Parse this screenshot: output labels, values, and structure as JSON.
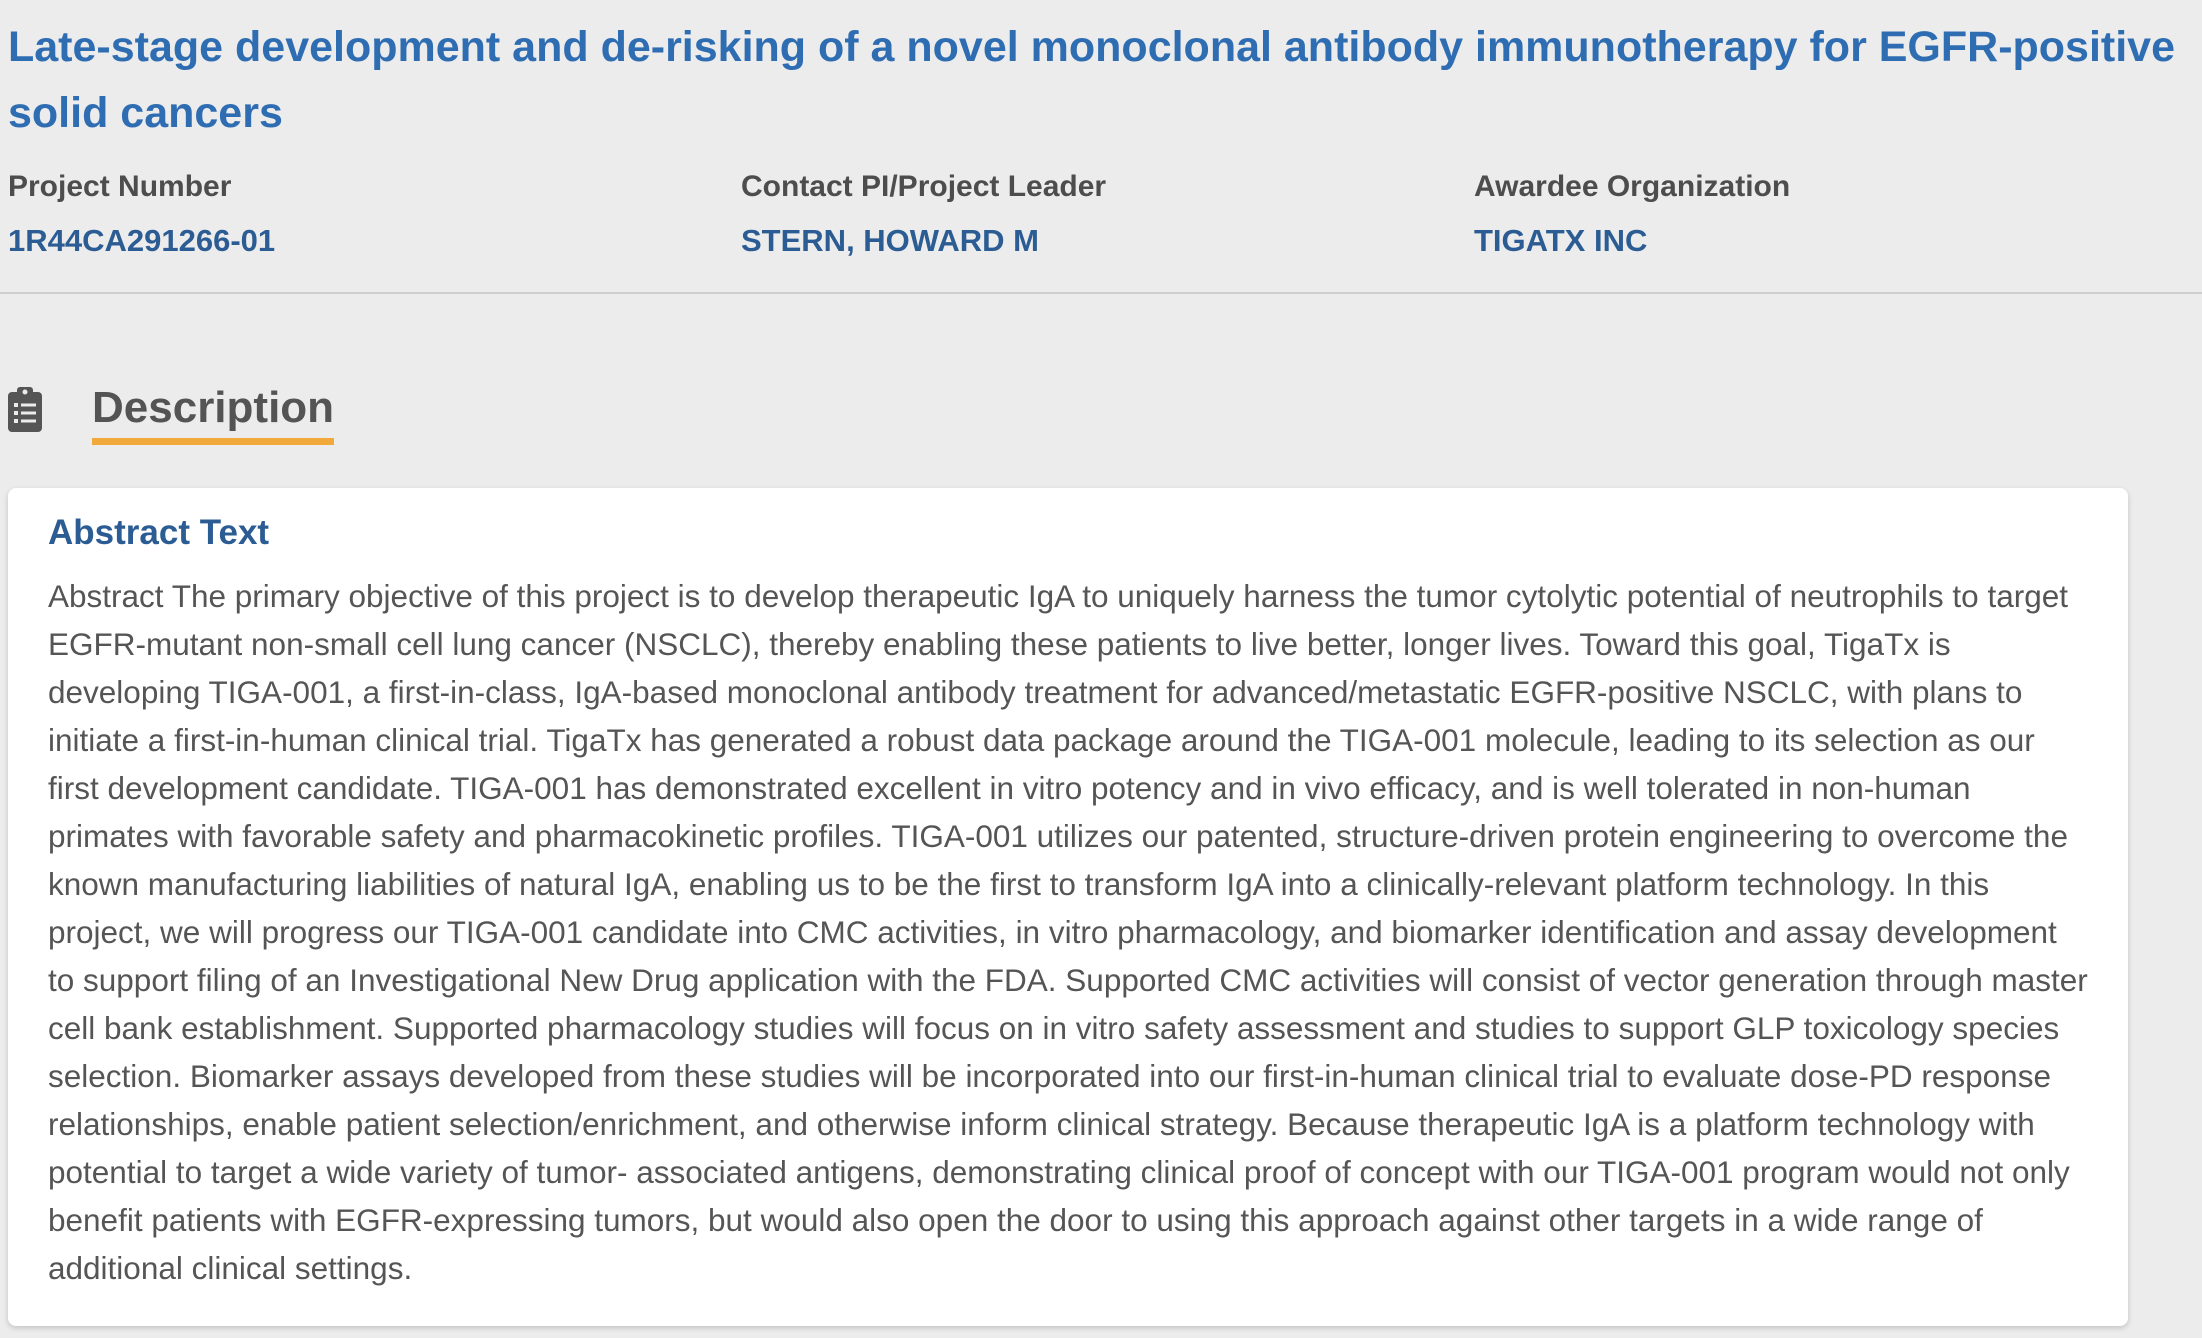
{
  "project": {
    "title": "Late-stage development and de-risking of a novel monoclonal antibody immunotherapy for EGFR-positive solid cancers"
  },
  "meta": {
    "project_number_label": "Project Number",
    "project_number_value": "1R44CA291266-01",
    "contact_pi_label": "Contact PI/Project Leader",
    "contact_pi_value": "STERN, HOWARD M",
    "awardee_label": "Awardee Organization",
    "awardee_value": "TIGATX INC"
  },
  "section": {
    "icon": "clipboard-list-icon",
    "title": "Description"
  },
  "abstract": {
    "heading": "Abstract Text",
    "body": "Abstract The primary objective of this project is to develop therapeutic IgA to uniquely harness the tumor cytolytic potential of neutrophils to target EGFR-mutant non-small cell lung cancer (NSCLC), thereby enabling these patients to live better, longer lives. Toward this goal, TigaTx is developing TIGA-001, a first-in-class, IgA-based monoclonal antibody treatment for advanced/metastatic EGFR-positive NSCLC, with plans to initiate a first-in-human clinical trial. TigaTx has generated a robust data package around the TIGA-001 molecule, leading to its selection as our first development candidate. TIGA-001 has demonstrated excellent in vitro potency and in vivo efficacy, and is well tolerated in non-human primates with favorable safety and pharmacokinetic profiles. TIGA-001 utilizes our patented, structure-driven protein engineering to overcome the known manufacturing liabilities of natural IgA, enabling us to be the first to transform IgA into a clinically-relevant platform technology. In this project, we will progress our TIGA-001 candidate into CMC activities, in vitro pharmacology, and biomarker identification and assay development to support filing of an Investigational New Drug application with the FDA. Supported CMC activities will consist of vector generation through master cell bank establishment. Supported pharmacology studies will focus on in vitro safety assessment and studies to support GLP toxicology species selection. Biomarker assays developed from these studies will be incorporated into our first-in-human clinical trial to evaluate dose-PD response relationships, enable patient selection/enrichment, and otherwise inform clinical strategy. Because therapeutic IgA is a platform technology with potential to target a wide variety of tumor- associated antigens, demonstrating clinical proof of concept with our TIGA-001 program would not only benefit patients with EGFR-expressing tumors, but would also open the door to using this approach against other targets in a wide range of additional clinical settings."
  },
  "colors": {
    "title_blue": "#2f6db3",
    "link_blue": "#2b5c93",
    "accent_orange": "#f0a93a",
    "background": "#ececec"
  }
}
